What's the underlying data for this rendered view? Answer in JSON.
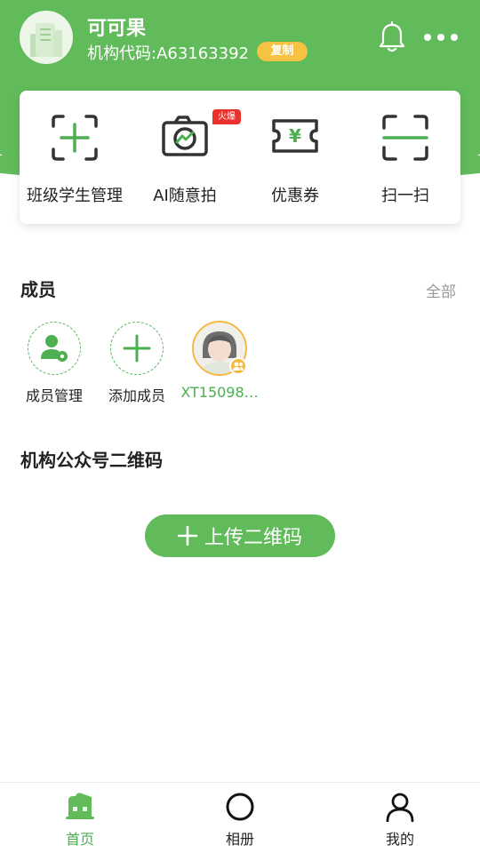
{
  "header": {
    "org_name": "可可果",
    "org_code": "机构代码:A63163392",
    "copy_label": "复制",
    "bell_icon": "bell-icon",
    "more_icon": "more-icon"
  },
  "quick_actions": [
    {
      "label": "班级学生管理",
      "icon": "class-frame-icon"
    },
    {
      "label": "AI随意拍",
      "icon": "camera-icon",
      "badge": "火爆"
    },
    {
      "label": "优惠券",
      "icon": "coupon-icon"
    },
    {
      "label": "扫一扫",
      "icon": "scan-icon"
    }
  ],
  "members": {
    "title": "成员",
    "see_all": "全部",
    "items": [
      {
        "label": "成员管理",
        "icon": "member-manage-icon"
      },
      {
        "label": "添加成员",
        "icon": "plus-icon"
      },
      {
        "label": "XT15098…",
        "icon": "member-avatar"
      }
    ]
  },
  "qrcode": {
    "title": "机构公众号二维码",
    "upload_label": "上传二维码"
  },
  "tabbar": {
    "items": [
      {
        "label": "首页",
        "icon": "home-icon",
        "active": true
      },
      {
        "label": "相册",
        "icon": "album-icon",
        "active": false
      },
      {
        "label": "我的",
        "icon": "profile-icon",
        "active": false
      }
    ]
  },
  "colors": {
    "primary": "#62bb5a",
    "badge_yellow": "#f5c242",
    "hot_red": "#e8322b"
  }
}
